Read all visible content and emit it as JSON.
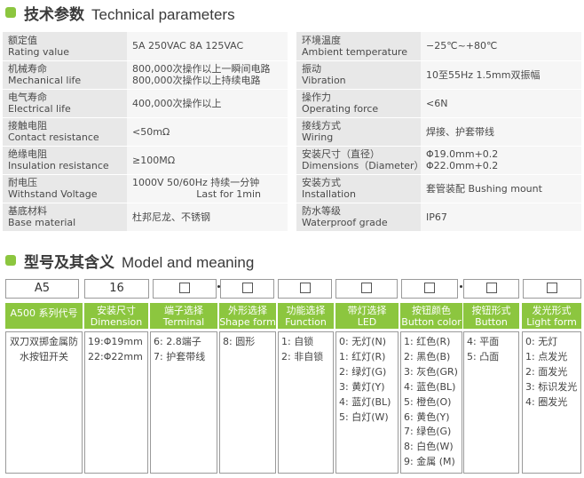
{
  "section1": {
    "title_zh": "技术参数",
    "title_en": "Technical parameters"
  },
  "params_left": [
    {
      "zh": "额定值",
      "en": "Rating value",
      "value": [
        "5A 250VAC  8A 125VAC"
      ]
    },
    {
      "zh": "机械寿命",
      "en": "Mechanical life",
      "value": [
        "800,000次操作以上一瞬间电路",
        "800,000次操作以上持续电路"
      ]
    },
    {
      "zh": "电气寿命",
      "en": "Electrical life",
      "value": [
        "400,000次操作以上"
      ]
    },
    {
      "zh": "接触电阻",
      "en": "Contact resistance",
      "value": [
        "<50mΩ"
      ]
    },
    {
      "zh": "绝缘电阻",
      "en": "Insulation resistance",
      "value": [
        "≥100MΩ"
      ]
    },
    {
      "zh": "耐电压",
      "en": "Withstand Voltage",
      "value": [
        "1000V 50/60Hz 持续一分钟",
        "Last for 1min"
      ]
    },
    {
      "zh": "基底材料",
      "en": "Base material",
      "value": [
        "杜邦尼龙、不锈钢"
      ]
    }
  ],
  "params_right": [
    {
      "zh": "环境温度",
      "en": "Ambient temperature",
      "value": [
        "−25℃~+80℃"
      ]
    },
    {
      "zh": "振动",
      "en": "Vibration",
      "value": [
        "10至55Hz 1.5mm双振幅"
      ]
    },
    {
      "zh": "操作力",
      "en": "Operating force",
      "value": [
        "<6N"
      ]
    },
    {
      "zh": "接线方式",
      "en": "Wiring",
      "value": [
        "焊接、护套带线"
      ]
    },
    {
      "zh": "安装尺寸（直径）",
      "en": "Dimensions（Diameter）",
      "value": [
        "Φ19.0mm+0.2",
        "Φ22.0mm+0.2"
      ]
    },
    {
      "zh": "安装方式",
      "en": "Installation",
      "value": [
        "套管装配  Bushing mount"
      ]
    },
    {
      "zh": "防水等级",
      "en": "Waterproof grade",
      "value": [
        "IP67"
      ]
    }
  ],
  "section2": {
    "title_zh": "型号及其含义",
    "title_en": "Model and meaning"
  },
  "model_columns": [
    {
      "code": "A5",
      "zh": "A500 系列代号",
      "en": "",
      "items": [
        "双刀双掷金属防",
        "水按钮开关"
      ]
    },
    {
      "code": "16",
      "zh": "安装尺寸",
      "en": "Dimension",
      "items": [
        "19:Φ19mm",
        "22:Φ22mm"
      ]
    },
    {
      "code": "",
      "zh": "端子选择",
      "en": "Terminal",
      "items": [
        "6: 2.8端子",
        "7: 护套带线"
      ]
    },
    {
      "code": "",
      "zh": "外形选择",
      "en": "Shape form",
      "items": [
        "8: 圆形"
      ]
    },
    {
      "code": "",
      "zh": "功能选择",
      "en": "Function",
      "items": [
        "1: 自锁",
        "2: 非自锁"
      ]
    },
    {
      "code": "",
      "zh": "带灯选择",
      "en": "LED",
      "items": [
        "0: 无灯(N)",
        "1: 红灯(R)",
        "2: 绿灯(G)",
        "3: 黄灯(Y)",
        "4: 蓝灯(BL)",
        "5: 白灯(W)"
      ]
    },
    {
      "code": "",
      "zh": "按钮颜色",
      "en": "Button color",
      "items": [
        "1: 红色(R)",
        "2: 黑色(B)",
        "3: 灰色(GR)",
        "4: 蓝色(BL)",
        "5: 橙色(O)",
        "6: 黄色(Y)",
        "7: 绿色(G)",
        "8: 白色(W)",
        "9: 金属 (M)"
      ]
    },
    {
      "code": "",
      "zh": "按钮形式",
      "en": "Button form",
      "items": [
        "4: 平面",
        "5: 凸面"
      ]
    },
    {
      "code": "",
      "zh": "发光形式",
      "en": "Light form",
      "items": [
        "0: 无灯",
        "1: 点发光",
        "2: 面发光",
        "3: 标识发光",
        "4: 圈发光"
      ]
    }
  ],
  "colors": {
    "accent": "#8cc63f",
    "label_bg": "#e8e8e8",
    "value_bg": "#f6f6f6"
  }
}
